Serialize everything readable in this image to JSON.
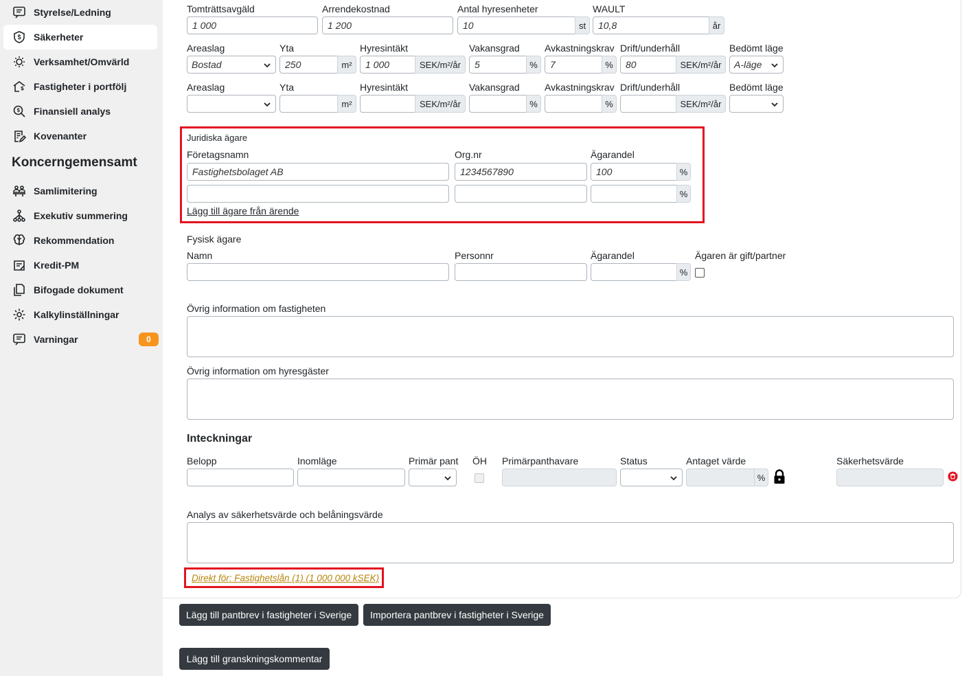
{
  "sidebar": {
    "items": [
      {
        "label": "Styrelse/Ledning",
        "icon": "message-list-icon"
      },
      {
        "label": "Säkerheter",
        "icon": "shield-dollar-icon",
        "active": true
      },
      {
        "label": "Verksamhet/Omvärld",
        "icon": "lightbulb-icon"
      },
      {
        "label": "Fastigheter i portfölj",
        "icon": "house-dollar-icon"
      },
      {
        "label": "Finansiell analys",
        "icon": "search-dollar-icon"
      },
      {
        "label": "Kovenanter",
        "icon": "document-edit-icon"
      }
    ],
    "group_heading": "Koncerngemensamt",
    "group_items": [
      {
        "label": "Samlimitering",
        "icon": "group-icon"
      },
      {
        "label": "Exekutiv summering",
        "icon": "hierarchy-icon"
      },
      {
        "label": "Rekommendation",
        "icon": "brain-icon"
      },
      {
        "label": "Kredit-PM",
        "icon": "document-pen-icon"
      },
      {
        "label": "Bifogade dokument",
        "icon": "documents-icon"
      },
      {
        "label": "Kalkylinställningar",
        "icon": "gear-icon"
      },
      {
        "label": "Varningar",
        "icon": "message-alert-icon",
        "badge": "0"
      }
    ],
    "badge_color": "#f7941d"
  },
  "top_row": {
    "tomtratt_label": "Tomträttsavgäld",
    "tomtratt_value": "1 000",
    "arrende_label": "Arrendekostnad",
    "arrende_value": "1 200",
    "hyresenheter_label": "Antal hyresenheter",
    "hyresenheter_value": "10",
    "hyresenheter_unit": "st",
    "wault_label": "WAULT",
    "wault_value": "10,8",
    "wault_unit": "år"
  },
  "area_rows": {
    "labels": {
      "areaslag": "Areaslag",
      "yta": "Yta",
      "hyresintakt": "Hyresintäkt",
      "vakansgrad": "Vakansgrad",
      "avkastningskrav": "Avkastningskrav",
      "drift": "Drift/underhåll",
      "lage": "Bedömt läge"
    },
    "units": {
      "yta": "m²",
      "hyres": "SEK/m²/år",
      "vakans": "%",
      "avk": "%",
      "drift": "SEK/m²/år"
    },
    "row1": {
      "areaslag": "Bostad",
      "yta": "250",
      "hyresintakt": "1 000",
      "vakansgrad": "5",
      "avkastningskrav": "7",
      "drift": "80",
      "lage": "A-läge"
    },
    "row2": {
      "areaslag": "",
      "yta": "",
      "hyresintakt": "",
      "vakansgrad": "",
      "avkastningskrav": "",
      "drift": "",
      "lage": ""
    }
  },
  "juridiska": {
    "title": "Juridiska ägare",
    "col_foretag": "Företagsnamn",
    "col_orgnr": "Org.nr",
    "col_andel": "Ägarandel",
    "rows": [
      {
        "foretag": "Fastighetsbolaget AB",
        "orgnr": "1234567890",
        "andel": "100"
      },
      {
        "foretag": "",
        "orgnr": "",
        "andel": ""
      }
    ],
    "unit": "%",
    "add_link": "Lägg till ägare från ärende"
  },
  "fysisk": {
    "title": "Fysisk ägare",
    "col_namn": "Namn",
    "col_personnr": "Personnr",
    "col_andel": "Ägarandel",
    "col_gift": "Ägaren är gift/partner",
    "unit": "%"
  },
  "ovrig_fastighet_label": "Övrig information om fastigheten",
  "ovrig_hyresgaster_label": "Övrig information om hyresgäster",
  "inteckningar": {
    "title": "Inteckningar",
    "col_belopp": "Belopp",
    "col_inomlage": "Inomläge",
    "col_primar_pant": "Primär pant",
    "col_oh": "ÖH",
    "col_primarpanthavare": "Primärpanthavare",
    "col_status": "Status",
    "col_antaget": "Antaget värde",
    "col_sakerhetsvarde": "Säkerhetsvärde",
    "antaget_unit": "%"
  },
  "analys_label": "Analys av säkerhetsvärde och belåningsvärde",
  "direkt_link": "Direkt för: Fastighetslån (1) (1 000 000 kSEK)",
  "direkt_link_color": "#b8860b",
  "highlight_color": "#e3121f",
  "buttons": {
    "add_pantbrev": "Lägg till pantbrev i fastigheter i Sverige",
    "import_pantbrev": "Importera pantbrev i fastigheter i Sverige",
    "add_kommentar": "Lägg till granskningskommentar"
  }
}
